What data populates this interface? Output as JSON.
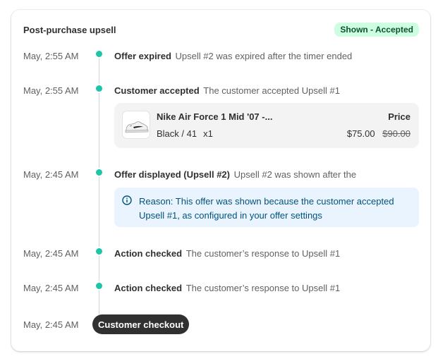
{
  "card": {
    "title": "Post-purchase upsell",
    "status_badge": "Shown - Accepted"
  },
  "events": [
    {
      "time": "May, 2:55 AM",
      "label": "Offer expired",
      "description": "Upsell #2 was expired after the timer ended"
    },
    {
      "time": "May, 2:55 AM",
      "label": "Customer accepted",
      "description": "The customer accepted Upsell #1"
    },
    {
      "time": "May, 2:45 AM",
      "label": "Offer displayed (Upsell #2)",
      "description": "Upsell #2 was shown after the"
    },
    {
      "time": "May, 2:45 AM",
      "label": "Action checked",
      "description": "The customer’s response to Upsell #1"
    },
    {
      "time": "May, 2:45 AM",
      "label": "Action checked",
      "description": "The customer’s response to Upsell #1"
    },
    {
      "time": "May, 2:45 AM",
      "label": "Customer checkout"
    }
  ],
  "product": {
    "name": "Nike Air Force 1 Mid '07 -...",
    "variant": "Black / 41",
    "quantity": "x1",
    "price_label": "Price",
    "price": "$75.00",
    "original_price": "$90.00",
    "thumbnail_icon": "sneaker-thumbnail"
  },
  "reason": {
    "icon": "info-icon",
    "text": "Reason: This offer was shown because the customer accepted Upsell #1, as configured in your offer settings"
  },
  "colors": {
    "badge_bg": "#cdfee1",
    "badge_text": "#0c5132",
    "dot": "#1cc5a8",
    "info_bg": "#eaf4ff",
    "info_text": "#00527c",
    "pill_bg": "#303030"
  }
}
